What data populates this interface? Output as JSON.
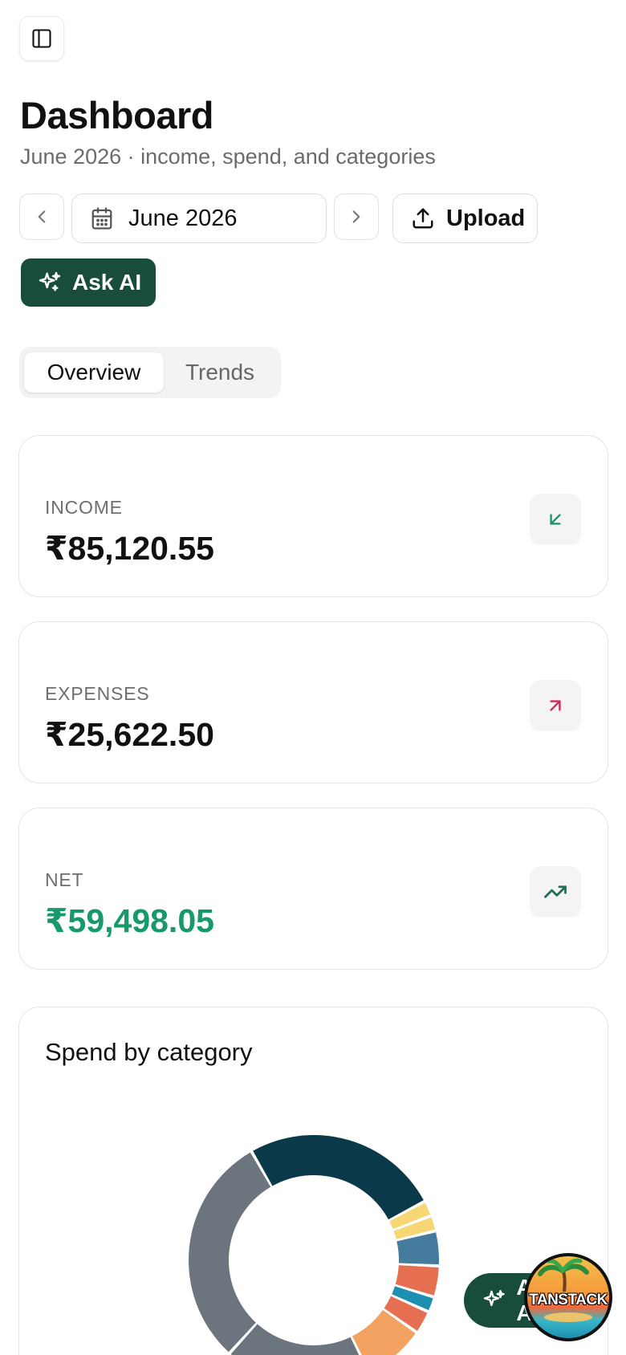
{
  "header": {
    "title": "Dashboard",
    "subtitle": "June 2026 · income, spend, and categories"
  },
  "toolbar": {
    "month_label": "June 2026",
    "upload_label": "Upload",
    "ask_ai_label": "Ask AI"
  },
  "tabs": [
    {
      "label": "Overview",
      "active": true
    },
    {
      "label": "Trends",
      "active": false
    }
  ],
  "stats": [
    {
      "label": "INCOME",
      "value": "₹85,120.55",
      "icon": "arrow-down-left-icon",
      "color": "#17996a"
    },
    {
      "label": "EXPENSES",
      "value": "₹25,622.50",
      "icon": "arrow-up-right-icon",
      "color": "#d6265b"
    },
    {
      "label": "NET",
      "value": "₹59,498.05",
      "icon": "trending-up-icon",
      "color": "#17996a"
    }
  ],
  "spend_chart": {
    "title": "Spend by category",
    "segment_colors": [
      "#0a3a4a",
      "#f7d774",
      "#457b9d",
      "#e76f51",
      "#1d8fb0",
      "#f4a261",
      "#6c757d"
    ]
  },
  "fab": {
    "label": "Ask AI"
  },
  "devtools": {
    "badge_text": "TANSTACK"
  },
  "colors": {
    "primary": "#174d3a",
    "positive": "#17996a",
    "negative": "#d6265b"
  }
}
